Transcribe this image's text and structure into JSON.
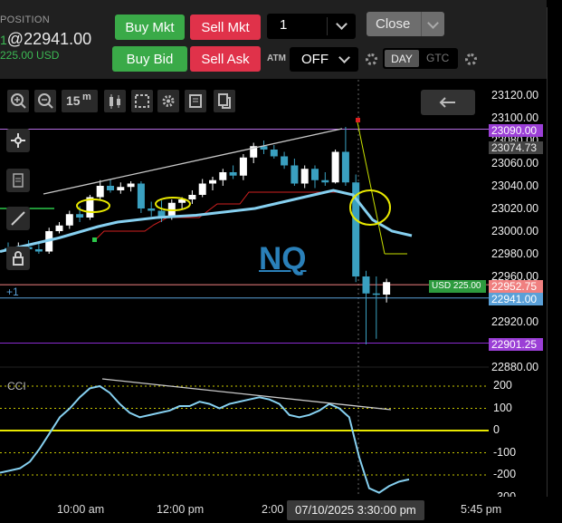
{
  "position": {
    "label": "POSITION",
    "qty": "1",
    "price": "@22941.00",
    "pnl": "225.00 USD"
  },
  "orders": {
    "buy_mkt": "Buy Mkt",
    "sell_mkt": "Sell Mkt",
    "buy_bid": "Buy Bid",
    "sell_ask": "Sell Ask",
    "quantity": "1",
    "close": "Close",
    "atm_label": "ATM",
    "atm_value": "OFF",
    "tif_day": "DAY",
    "tif_gtc": "GTC"
  },
  "colors": {
    "buy": "#3aaa48",
    "sell": "#e0324a",
    "ema": "#86d0f0",
    "signal": "#e8e800",
    "trendline": "#c8c8c8"
  },
  "toolbar": {
    "timeframe": "15",
    "timeframe_unit": "m",
    "icons": [
      "zoom-in-icon",
      "zoom-out-icon",
      "candles-icon",
      "select-icon",
      "gear-icon",
      "template-icon",
      "copy-icon"
    ],
    "back_icon": "arrow-left-icon"
  },
  "left_tools": [
    "crosshair-icon",
    "note-icon",
    "line-icon",
    "lock-icon"
  ],
  "symbol_text": "NQ",
  "position_marker": "+1",
  "cci_label": "CCI",
  "price_axis": {
    "ticks": [
      "23120.00",
      "23100.00",
      "23080.00",
      "23060.00",
      "23040.00",
      "23020.00",
      "23000.00",
      "22980.00",
      "22960.00",
      "22940.00",
      "22920.00",
      "22900.00",
      "22880.00"
    ],
    "tags": {
      "upper": "23090.00",
      "last_high": "23074.73",
      "pnl_tag": "USD 225.00",
      "entry": "22952.75",
      "position_price": "22941.00",
      "lower": "22901.25"
    }
  },
  "cci_axis": {
    "ticks": [
      "200",
      "100",
      "0",
      "-100",
      "-200",
      "-300"
    ]
  },
  "time_axis": {
    "ticks": [
      "10:00 am",
      "12:00 pm",
      "2:00",
      "5:45 pm"
    ],
    "crosshair": "07/10/2025 3:30:00 pm"
  },
  "chart_data": {
    "type": "candlestick",
    "symbol": "NQ",
    "interval": "15m",
    "price_range": [
      22870,
      23130
    ],
    "candles": [
      {
        "o": 22985,
        "h": 22990,
        "l": 22978,
        "c": 22984
      },
      {
        "o": 22984,
        "h": 22990,
        "l": 22980,
        "c": 22986
      },
      {
        "o": 22986,
        "h": 22992,
        "l": 22982,
        "c": 22984
      },
      {
        "o": 22984,
        "h": 22990,
        "l": 22980,
        "c": 22982
      },
      {
        "o": 22982,
        "h": 23003,
        "l": 22980,
        "c": 23000
      },
      {
        "o": 23000,
        "h": 23008,
        "l": 22998,
        "c": 23005
      },
      {
        "o": 23005,
        "h": 23018,
        "l": 23002,
        "c": 23015
      },
      {
        "o": 23015,
        "h": 23022,
        "l": 23008,
        "c": 23012
      },
      {
        "o": 23012,
        "h": 23032,
        "l": 23010,
        "c": 23030
      },
      {
        "o": 23030,
        "h": 23045,
        "l": 23028,
        "c": 23040
      },
      {
        "o": 23040,
        "h": 23046,
        "l": 23034,
        "c": 23036
      },
      {
        "o": 23036,
        "h": 23043,
        "l": 23033,
        "c": 23039
      },
      {
        "o": 23039,
        "h": 23044,
        "l": 23035,
        "c": 23042
      },
      {
        "o": 23042,
        "h": 23044,
        "l": 23016,
        "c": 23020
      },
      {
        "o": 23020,
        "h": 23026,
        "l": 23013,
        "c": 23018
      },
      {
        "o": 23018,
        "h": 23027,
        "l": 23008,
        "c": 23012
      },
      {
        "o": 23012,
        "h": 23028,
        "l": 23010,
        "c": 23025
      },
      {
        "o": 23025,
        "h": 23030,
        "l": 23020,
        "c": 23028
      },
      {
        "o": 23028,
        "h": 23036,
        "l": 23024,
        "c": 23032
      },
      {
        "o": 23032,
        "h": 23046,
        "l": 23030,
        "c": 23042
      },
      {
        "o": 23042,
        "h": 23048,
        "l": 23036,
        "c": 23045
      },
      {
        "o": 23045,
        "h": 23055,
        "l": 23040,
        "c": 23052
      },
      {
        "o": 23052,
        "h": 23058,
        "l": 23046,
        "c": 23049
      },
      {
        "o": 23049,
        "h": 23068,
        "l": 23045,
        "c": 23065
      },
      {
        "o": 23065,
        "h": 23078,
        "l": 23060,
        "c": 23075
      },
      {
        "o": 23075,
        "h": 23080,
        "l": 23068,
        "c": 23072
      },
      {
        "o": 23072,
        "h": 23076,
        "l": 23064,
        "c": 23066
      },
      {
        "o": 23066,
        "h": 23070,
        "l": 23055,
        "c": 23058
      },
      {
        "o": 23058,
        "h": 23064,
        "l": 23040,
        "c": 23042
      },
      {
        "o": 23042,
        "h": 23058,
        "l": 23038,
        "c": 23055
      },
      {
        "o": 23055,
        "h": 23058,
        "l": 23038,
        "c": 23045
      },
      {
        "o": 23045,
        "h": 23052,
        "l": 23040,
        "c": 23043
      },
      {
        "o": 23043,
        "h": 23072,
        "l": 23042,
        "c": 23070
      },
      {
        "o": 23070,
        "h": 23092,
        "l": 23040,
        "c": 23043
      },
      {
        "o": 23043,
        "h": 23050,
        "l": 22955,
        "c": 22960
      },
      {
        "o": 22960,
        "h": 22965,
        "l": 22900,
        "c": 22945
      },
      {
        "o": 22945,
        "h": 22960,
        "l": 22905,
        "c": 22944
      },
      {
        "o": 22944,
        "h": 22958,
        "l": 22937,
        "c": 22955
      }
    ],
    "ema": [
      22982,
      22986,
      22990,
      22994,
      22999,
      23004,
      23008,
      23010,
      23012,
      23013,
      23014,
      23016,
      23018,
      23020,
      23024,
      23028,
      23032,
      23036,
      23032,
      23010,
      23000,
      22996
    ],
    "cci_range": [
      -310,
      210
    ],
    "cci": [
      -190,
      -180,
      -170,
      -140,
      -80,
      -10,
      60,
      100,
      150,
      190,
      200,
      170,
      120,
      80,
      60,
      70,
      80,
      90,
      110,
      110,
      130,
      120,
      100,
      120,
      130,
      140,
      150,
      140,
      120,
      70,
      60,
      70,
      90,
      120,
      100,
      60,
      -120,
      -260,
      -280,
      -250,
      -230,
      -220
    ],
    "levels": [
      23090,
      22952.75,
      22941,
      22901.25
    ]
  }
}
